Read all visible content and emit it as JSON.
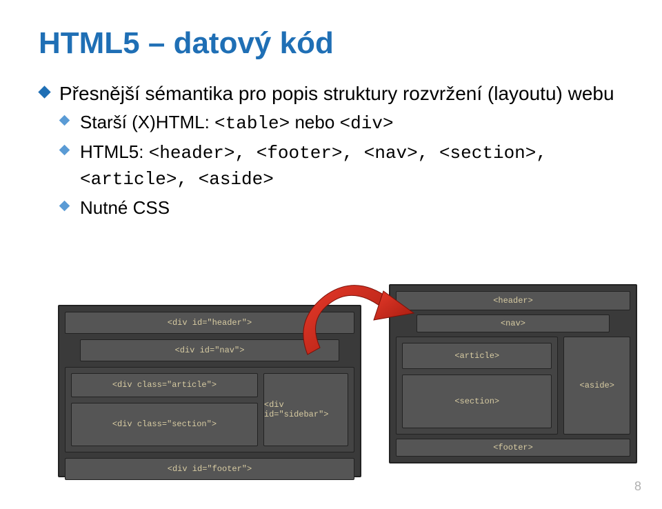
{
  "title": "HTML5 – datový kód",
  "bullets": [
    {
      "text": "Přesnější sémantika pro popis struktury rozvržení (layoutu) webu",
      "sub": [
        {
          "prefix": "Starší (X)HTML: ",
          "code1": "<table>",
          "mid": " nebo ",
          "code2": "<div>"
        },
        {
          "prefix": "HTML5: ",
          "code1": "<header>, <footer>, <nav>, <section>, <article>, <aside>"
        },
        {
          "plain": "Nutné CSS"
        }
      ]
    }
  ],
  "page_number": "8",
  "old_diagram": {
    "header": "<div id=\"header\">",
    "nav": "<div id=\"nav\">",
    "article": "<div class=\"article\">",
    "section": "<div class=\"section\">",
    "sidebar": "<div id=\"sidebar\">",
    "footer": "<div id=\"footer\">"
  },
  "new_diagram": {
    "header": "<header>",
    "nav": "<nav>",
    "article": "<article>",
    "section": "<section>",
    "aside": "<aside>",
    "footer": "<footer>"
  }
}
